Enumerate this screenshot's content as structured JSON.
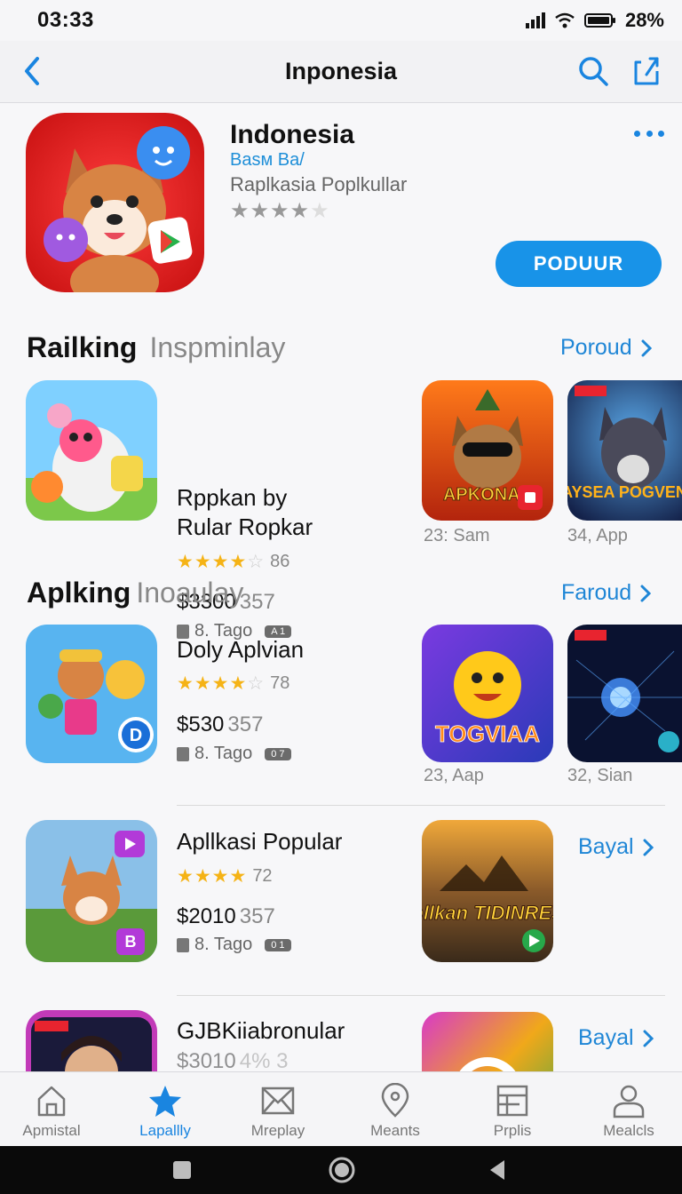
{
  "status": {
    "time": "03:33",
    "battery": "28%"
  },
  "nav": {
    "title": "Inponesia"
  },
  "hero": {
    "title": "Indonesia",
    "subtitle": "Basм Ba/",
    "category": "Raplkasia Poplkullar",
    "rating_stars": 4,
    "rating_max": 5,
    "get_label": "PODUUR"
  },
  "sections": [
    {
      "title": "Railking",
      "subtitle": "Inspminlay",
      "link": "Poroud"
    },
    {
      "title": "Aplking",
      "subtitle": "Inoaulay",
      "link": "Faroud"
    }
  ],
  "apps": [
    {
      "name_line1": "Rppkan by",
      "name_line2": "Rular Ropkar",
      "stars": 4,
      "count": "86",
      "price": "$3300",
      "num": "357",
      "tag": "8. Tago",
      "pill": "A 1"
    },
    {
      "name_line1": "Doly Aplvian",
      "stars": 4,
      "count": "78",
      "price": "$530",
      "num": "357",
      "tag": "8. Tago",
      "pill": "0 7"
    },
    {
      "name_line1": "Apllkasi Popular",
      "stars": 4,
      "count": "72",
      "price": "$2010",
      "num": "357",
      "tag": "8. Tago",
      "pill": "0 1"
    },
    {
      "name_line1": "GJBKiiabronular",
      "price": "$3010",
      "num": "4% 3"
    }
  ],
  "thumbs": [
    {
      "caption": "23: Sam",
      "art": "APKONAE"
    },
    {
      "caption": "34, App",
      "art": "AYSEA POGVENS"
    },
    {
      "caption": "23, Aap",
      "art": "TOGVIAA"
    },
    {
      "caption": "32, Sian"
    },
    {
      "art": "Apllkan TIDINRESS"
    }
  ],
  "side_links": [
    {
      "label": "Bayal"
    },
    {
      "label": "Bayal"
    }
  ],
  "tabs": [
    {
      "label": "Apmistal",
      "icon": "home-icon"
    },
    {
      "label": "Lapallly",
      "icon": "star-icon",
      "active": true
    },
    {
      "label": "Mreplay",
      "icon": "envelope-icon"
    },
    {
      "label": "Meants",
      "icon": "map-pin-icon"
    },
    {
      "label": "Prplis",
      "icon": "grid-icon"
    },
    {
      "label": "Mealcls",
      "icon": "person-icon"
    }
  ],
  "colors": {
    "accent": "#1a85e0",
    "star": "#f5b316",
    "button": "#1893e8"
  }
}
